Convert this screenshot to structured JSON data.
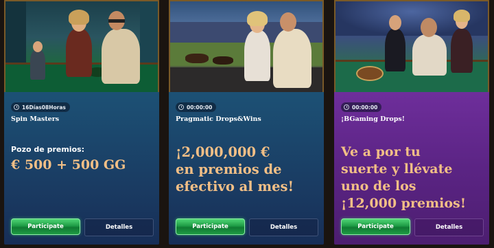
{
  "cards": [
    {
      "banner_image": "casino-couple-roulette-illustration",
      "timer": "16Días08Horas",
      "title": "Spin Masters",
      "prize_label": "Pozo de premios:",
      "prize_value": "€ 500 + 500 GG",
      "participate_label": "Participate",
      "details_label": "Detalles"
    },
    {
      "banner_image": "horse-race-couple-illustration",
      "timer": "00:00:00",
      "title": "Pragmatic Drops&Wins",
      "promo_lines": [
        "¡2,000,000 €",
        "en premios de",
        "efectivo al mes!"
      ],
      "participate_label": "Participate",
      "details_label": "Detalles"
    },
    {
      "banner_image": "casino-group-roulette-illustration",
      "timer": "00:00:00",
      "title": "¡BGaming Drops!",
      "promo_lines": [
        "Ve a por tu",
        "suerte y llévate",
        "uno de los",
        "¡12,000 premios!"
      ],
      "participate_label": "Participate",
      "details_label": "Detalles"
    }
  ],
  "colors": {
    "prize_text": "#f2bf86",
    "button_green": "#1e9b45",
    "panel_blue": "#1a3c63",
    "panel_purple": "#5b2484"
  }
}
